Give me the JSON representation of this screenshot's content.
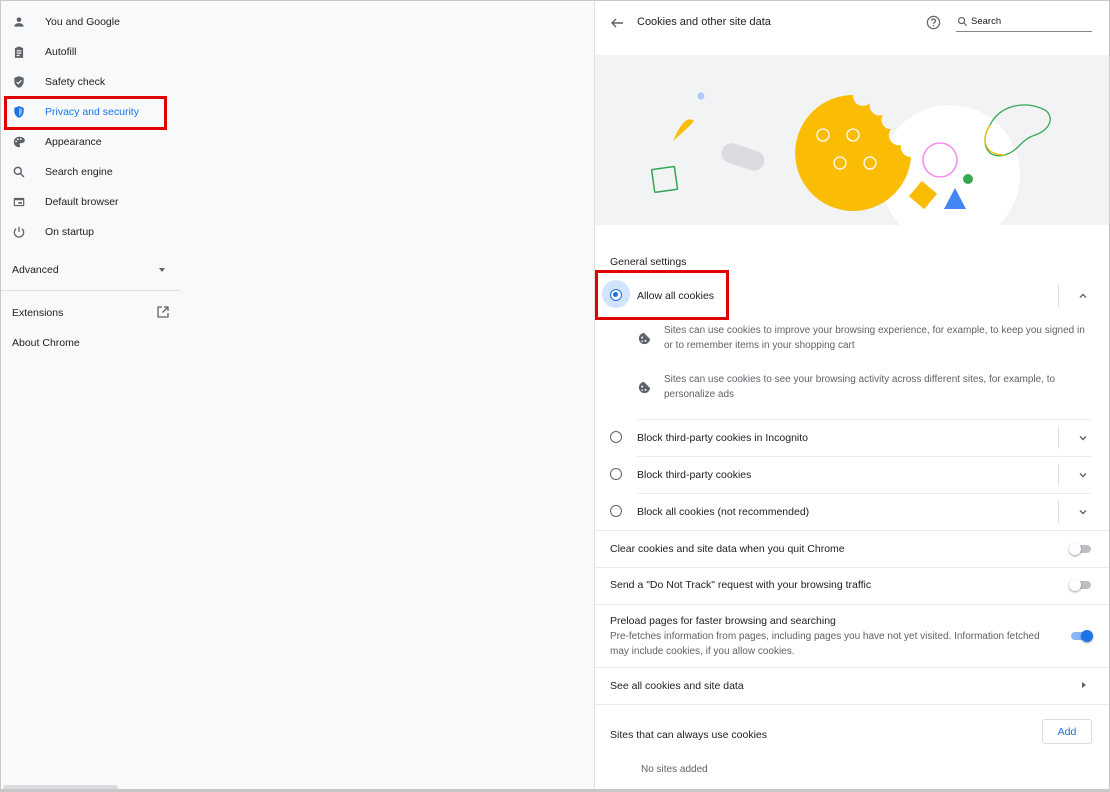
{
  "sidebar": {
    "items": [
      {
        "label": "You and Google",
        "icon": "person-icon"
      },
      {
        "label": "Autofill",
        "icon": "clipboard-icon"
      },
      {
        "label": "Safety check",
        "icon": "shield-check-icon"
      },
      {
        "label": "Privacy and security",
        "icon": "shield-icon",
        "active": true
      },
      {
        "label": "Appearance",
        "icon": "palette-icon"
      },
      {
        "label": "Search engine",
        "icon": "search-icon"
      },
      {
        "label": "Default browser",
        "icon": "browser-icon"
      },
      {
        "label": "On startup",
        "icon": "power-icon"
      }
    ],
    "advanced_label": "Advanced",
    "extensions_label": "Extensions",
    "about_label": "About Chrome"
  },
  "header": {
    "title": "Cookies and other site data",
    "search_placeholder": "Search"
  },
  "general": {
    "section_label": "General settings",
    "options": [
      {
        "label": "Allow all cookies",
        "selected": true
      },
      {
        "label": "Block third-party cookies in Incognito",
        "selected": false
      },
      {
        "label": "Block third-party cookies",
        "selected": false
      },
      {
        "label": "Block all cookies (not recommended)",
        "selected": false
      }
    ],
    "details": [
      "Sites can use cookies to improve your browsing experience, for example, to keep you signed in or to remember items in your shopping cart",
      "Sites can use cookies to see your browsing activity across different sites, for example, to personalize ads"
    ]
  },
  "settings": {
    "clear_on_quit": {
      "label": "Clear cookies and site data when you quit Chrome",
      "enabled": false
    },
    "do_not_track": {
      "label": "Send a \"Do Not Track\" request with your browsing traffic",
      "enabled": false
    },
    "preload": {
      "label": "Preload pages for faster browsing and searching",
      "description": "Pre-fetches information from pages, including pages you have not yet visited. Information fetched may include cookies, if you allow cookies.",
      "enabled": true
    },
    "see_all_label": "See all cookies and site data"
  },
  "allow_list": {
    "label": "Sites that can always use cookies",
    "add_label": "Add",
    "empty_text": "No sites added"
  },
  "colors": {
    "accent": "#1a73e8",
    "highlight": "#e00000",
    "cookie_yellow": "#fbbc04"
  }
}
